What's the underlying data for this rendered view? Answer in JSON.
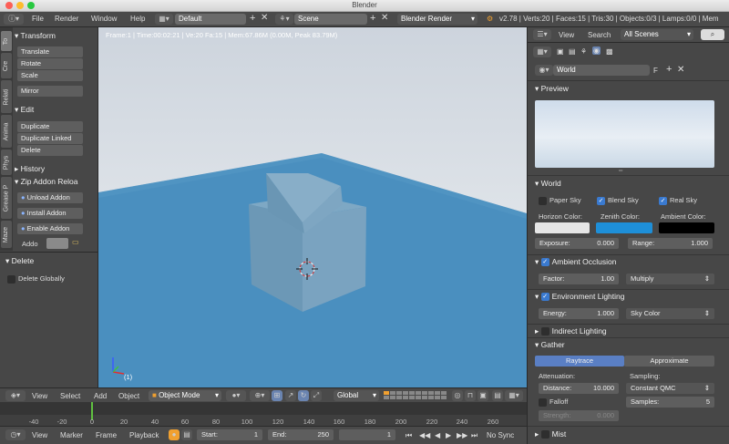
{
  "titlebar": {
    "title": "Blender"
  },
  "infobar": {
    "menus": [
      "File",
      "Render",
      "Window",
      "Help"
    ],
    "layout": "Default",
    "scene": "Scene",
    "engine": "Blender Render",
    "stats": "v2.78 | Verts:20 | Faces:15 | Tris:30 | Objects:0/3 | Lamps:0/0 | Mem"
  },
  "toolshelf": {
    "tabs": [
      "To",
      "Cre",
      "Relati",
      "Anima",
      "Phys",
      "Grease P",
      "Maze"
    ],
    "transform_header": "Transform",
    "transform_buttons": [
      "Translate",
      "Rotate",
      "Scale",
      "Mirror"
    ],
    "edit_header": "Edit",
    "edit_buttons": [
      "Duplicate",
      "Duplicate Linked",
      "Delete"
    ],
    "history_header": "History",
    "zip_header": "Zip Addon Reloa",
    "zip_buttons": [
      "Unload Addon",
      "Install Addon",
      "Enable Addon"
    ],
    "addo_label": "Addo",
    "delete_header": "Delete",
    "delete_globally": "Delete Globally"
  },
  "viewport": {
    "info": "Frame:1 | Time:00:02:21 | Ve:20 Fa:15 | Mem:67.86M (0.00M, Peak 83.79M)",
    "obj_label": "(1)"
  },
  "view3d_header": {
    "menus": [
      "View",
      "Select",
      "Add",
      "Object"
    ],
    "mode": "Object Mode",
    "orientation": "Global"
  },
  "timeline": {
    "ticks": [
      "-40",
      "-20",
      "0",
      "20",
      "40",
      "60",
      "80",
      "100",
      "120",
      "140",
      "160",
      "180",
      "200",
      "220",
      "240",
      "260"
    ]
  },
  "timeline_header": {
    "menus": [
      "View",
      "Marker",
      "Frame",
      "Playback"
    ],
    "start_label": "Start:",
    "start_val": "1",
    "end_label": "End:",
    "end_val": "250",
    "current_val": "1",
    "sync": "No Sync"
  },
  "props": {
    "header_menus": [
      "View",
      "Search"
    ],
    "scenes_select": "All Scenes",
    "world_name": "World",
    "world_f": "F",
    "preview_header": "Preview",
    "world_header": "World",
    "paper_sky": "Paper Sky",
    "blend_sky": "Blend Sky",
    "real_sky": "Real Sky",
    "horizon_label": "Horizon Color:",
    "zenith_label": "Zenith Color:",
    "ambient_label": "Ambient Color:",
    "exposure_label": "Exposure:",
    "exposure_val": "0.000",
    "range_label": "Range:",
    "range_val": "1.000",
    "ao_header": "Ambient Occlusion",
    "factor_label": "Factor:",
    "factor_val": "1.00",
    "multiply": "Multiply",
    "env_header": "Environment Lighting",
    "energy_label": "Energy:",
    "energy_val": "1.000",
    "sky_color": "Sky Color",
    "indirect_header": "Indirect Lighting",
    "gather_header": "Gather",
    "raytrace": "Raytrace",
    "approximate": "Approximate",
    "attenuation": "Attenuation:",
    "sampling": "Sampling:",
    "distance_label": "Distance:",
    "distance_val": "10.000",
    "constant_qmc": "Constant QMC",
    "falloff": "Falloff",
    "samples_label": "Samples:",
    "samples_val": "5",
    "strength_label": "Strength:",
    "strength_val": "0.000",
    "mist_header": "Mist"
  },
  "colors": {
    "horizon": "#e6e6e6",
    "zenith": "#1e8fd8",
    "ambient": "#000000",
    "accent": "#5a7fc4",
    "ground": "#4a8fbf"
  }
}
